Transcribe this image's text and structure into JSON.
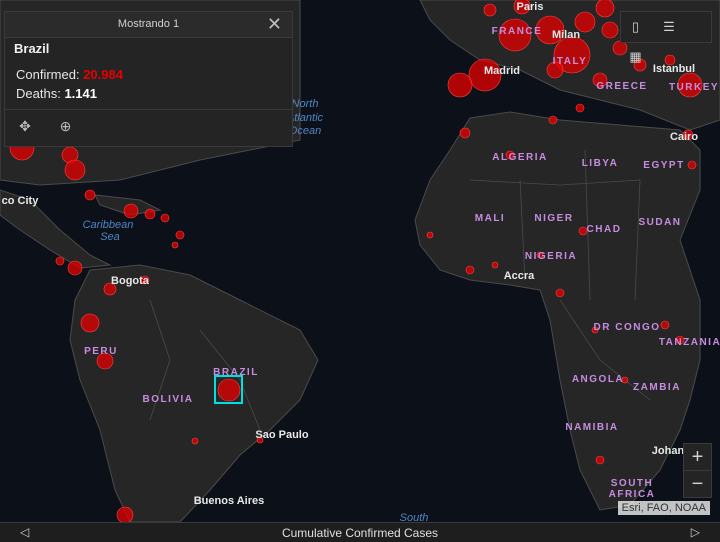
{
  "popup": {
    "header_title": "Mostrando 1",
    "country": "Brazil",
    "confirmed_label": "Confirmed:",
    "confirmed_value": "20.984",
    "deaths_label": "Deaths:",
    "deaths_value": "1.141",
    "actions": [
      "move-icon",
      "zoom-to-icon"
    ]
  },
  "widgets": [
    "bookmark-icon",
    "legend-list-icon",
    "basemap-grid-icon"
  ],
  "zoom": {
    "in_label": "+",
    "out_label": "−"
  },
  "attribution": "Esri, FAO, NOAA",
  "bottom_bar": {
    "label": "Cumulative Confirmed Cases"
  },
  "map": {
    "ocean_labels": [
      {
        "id": "ocean-north-atlantic-1",
        "text": "North"
      },
      {
        "id": "ocean-north-atlantic-2",
        "text": "Atlantic"
      },
      {
        "id": "ocean-north-atlantic-3",
        "text": "Ocean"
      },
      {
        "id": "sea-caribbean-1",
        "text": "Caribbean"
      },
      {
        "id": "sea-caribbean-2",
        "text": "Sea"
      },
      {
        "id": "ocean-south",
        "text": "South"
      }
    ],
    "country_labels": [
      "FRANCE",
      "ITALY",
      "GREECE",
      "TURKEY",
      "ALGERIA",
      "LIBYA",
      "EGYPT",
      "MALI",
      "NIGER",
      "CHAD",
      "SUDAN",
      "NIGERIA",
      "DR CONGO",
      "TANZANIA",
      "ANGOLA",
      "ZAMBIA",
      "NAMIBIA",
      "SOUTH",
      "AFRICA",
      "PERU",
      "BRAZIL",
      "BOLIVIA"
    ],
    "city_labels": [
      "Paris",
      "Milan",
      "Madrid",
      "Istanbul",
      "Cairo",
      "Accra",
      "Bogota",
      "Sao Paulo",
      "Buenos Aires",
      "Johan",
      "co City"
    ],
    "selected_country": "BRAZIL"
  },
  "colors": {
    "case_bubble": "#e60000",
    "land": "#262626",
    "ocean": "#0c1119",
    "country_label": "#c78ce0",
    "ocean_label": "#4f86c6",
    "selection": "#00e0e0"
  }
}
